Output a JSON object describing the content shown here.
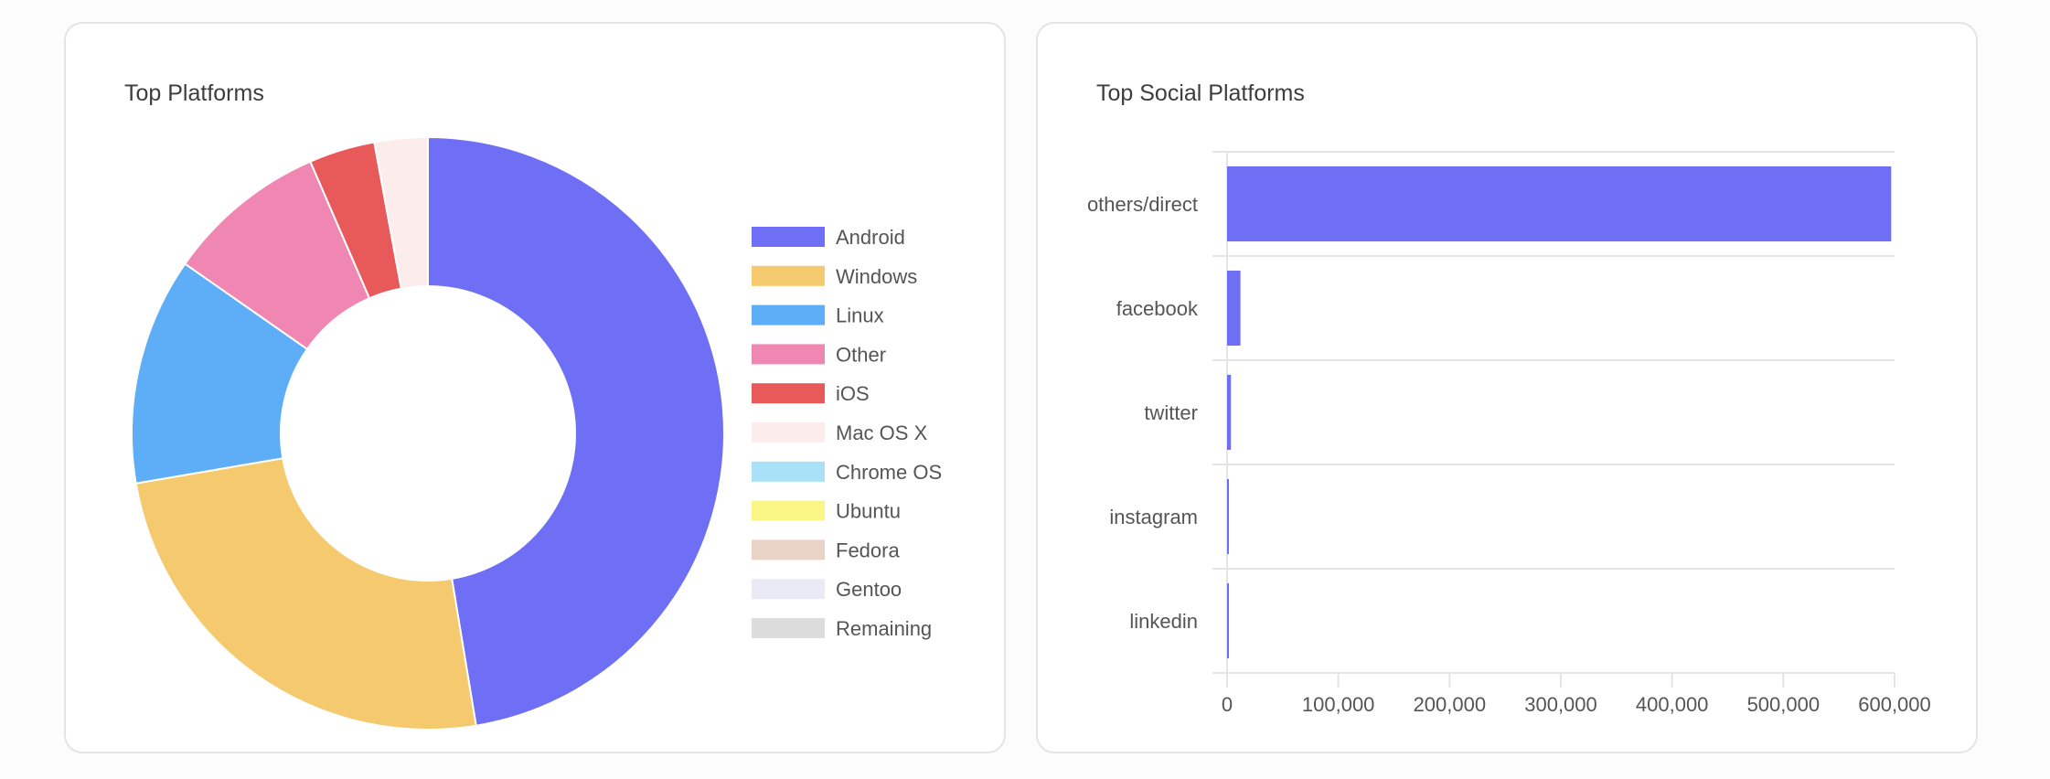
{
  "colors": {
    "android": "#6f6ff6",
    "windows": "#f5c96d",
    "linux": "#5daef7",
    "other": "#f087b3",
    "ios": "#e85a5a",
    "macosx": "#fcecec",
    "chromeos": "#a8e1f8",
    "ubuntu": "#f9f685",
    "fedora": "#e9d2c6",
    "gentoo": "#eaeaf6",
    "remaining": "#dcdcdc",
    "bar": "#6f6ff6"
  },
  "chart_data": [
    {
      "type": "pie",
      "title": "Top Platforms",
      "legend_position": "right",
      "labels": [
        "Android",
        "Windows",
        "Linux",
        "Other",
        "iOS",
        "Mac OS X",
        "Chrome OS",
        "Ubuntu",
        "Fedora",
        "Gentoo",
        "Remaining"
      ],
      "values": [
        47.4,
        24.9,
        12.4,
        8.8,
        3.6,
        2.9,
        0,
        0,
        0,
        0,
        0
      ],
      "value_unit": "percent (estimated from slice angles)",
      "color_keys": [
        "android",
        "windows",
        "linux",
        "other",
        "ios",
        "macosx",
        "chromeos",
        "ubuntu",
        "fedora",
        "gentoo",
        "remaining"
      ]
    },
    {
      "type": "bar",
      "orientation": "horizontal",
      "title": "Top Social Platforms",
      "categories": [
        "others/direct",
        "facebook",
        "twitter",
        "instagram",
        "linkedin"
      ],
      "values": [
        597000,
        12000,
        3500,
        1200,
        900
      ],
      "xlim": [
        0,
        600000
      ],
      "xticks": [
        0,
        100000,
        200000,
        300000,
        400000,
        500000,
        600000
      ],
      "xtick_labels": [
        "0",
        "100,000",
        "200,000",
        "300,000",
        "400,000",
        "500,000",
        "600,000"
      ],
      "grid": true
    }
  ]
}
